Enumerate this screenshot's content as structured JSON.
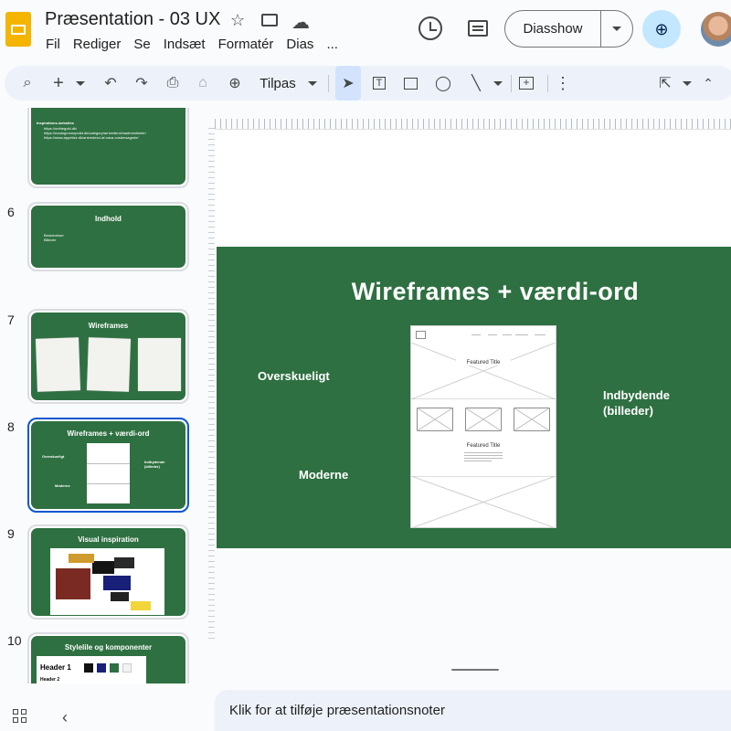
{
  "header": {
    "title": "Præsentation - 03 UX",
    "menu": [
      "Fil",
      "Rediger",
      "Se",
      "Indsæt",
      "Formatér",
      "Dias",
      "..."
    ],
    "slideshow_label": "Diasshow"
  },
  "toolbar": {
    "zoom_label": "Tilpas"
  },
  "sidebar": {
    "slides": [
      {
        "number": "",
        "title": "",
        "lines": [
          "Inspirations-websites",
          "https://onthegold.dk/",
          "https://madogmonopolet.dk/category/arrivederci/madmenikeler/",
          "https://www.appetize.dk/arrivederci-af-vaca-costensagede/"
        ]
      },
      {
        "number": "6",
        "title": "Indhold",
        "lines": [
          "Beskrivelser",
          "Billeder"
        ]
      },
      {
        "number": "7",
        "title": "Wireframes"
      },
      {
        "number": "8",
        "title": "Wireframes + værdi-ord",
        "labels": [
          "Overskueligt",
          "Moderne",
          "Indbydende (billeder)"
        ]
      },
      {
        "number": "9",
        "title": "Visual inspiration"
      },
      {
        "number": "10",
        "title": "Stylelile og komponenter",
        "lines": [
          "Header 1",
          "Header 2"
        ]
      }
    ]
  },
  "slide": {
    "title": "Wireframes + værdi-ord",
    "words": {
      "w1": "Overskueligt",
      "w2": "Moderne",
      "w3": "Indbydende",
      "w4": "(billeder)"
    },
    "wireframe": {
      "featured_title_1": "Featured Title",
      "featured_title_2": "Featured Title"
    },
    "background_color": "#2e7041"
  },
  "notes": {
    "placeholder": "Klik for at tilføje præsentationsnoter"
  },
  "colors": {
    "accent": "#0b57d0",
    "share_bg": "#c2e7ff",
    "slide_green": "#2e7041",
    "app_logo": "#f4b400"
  }
}
